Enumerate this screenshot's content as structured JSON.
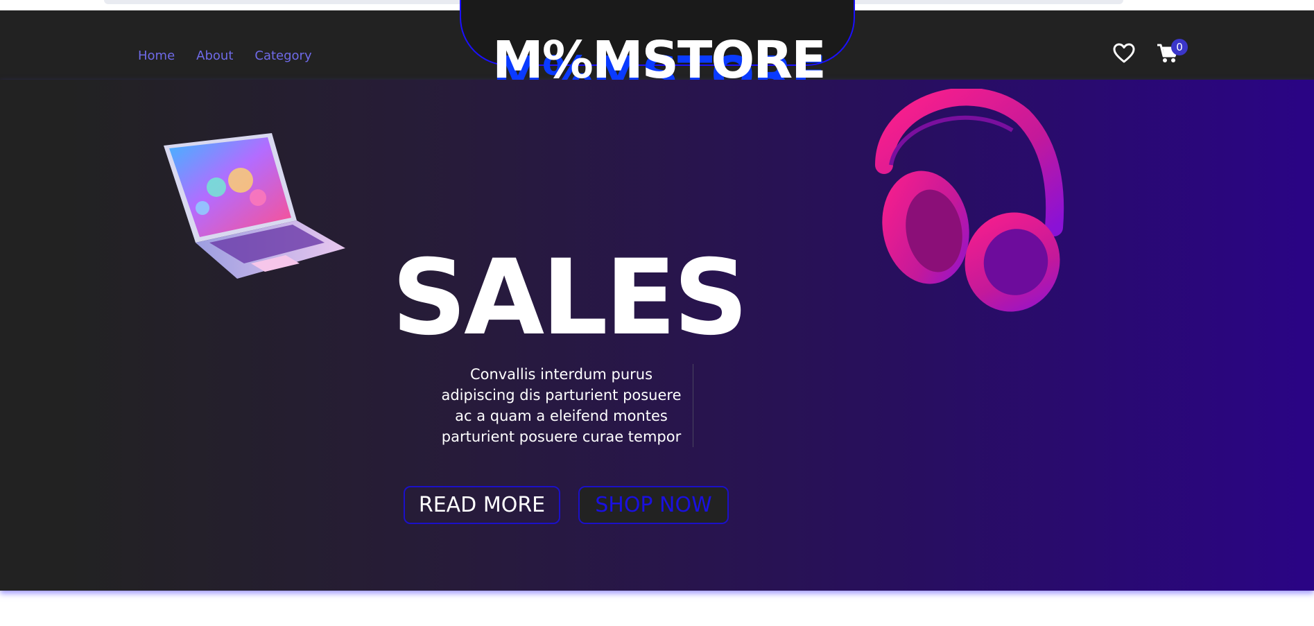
{
  "nav": {
    "items": [
      {
        "label": "Home"
      },
      {
        "label": "About"
      },
      {
        "label": "Category"
      }
    ]
  },
  "brand": {
    "logo_text": "M%MSTORE"
  },
  "header_icons": {
    "wishlist_icon": "heart-icon",
    "cart_icon": "cart-icon",
    "cart_count": "0"
  },
  "hero": {
    "headline": "SALES",
    "description": "Convallis interdum purus adipiscing dis parturient posuere ac a quam a eleifend montes parturient posuere curae tempor",
    "read_more_label": "READ MORE",
    "shop_now_label": "SHOP NOW",
    "images": [
      "laptop-image",
      "headphones-image"
    ]
  },
  "colors": {
    "header_bg": "#222222",
    "nav_link": "#6f6ae8",
    "accent_blue": "#1b10ff",
    "hero_gradient_start": "#222222",
    "hero_gradient_end": "#2a0485",
    "badge": "#3b36c9"
  }
}
